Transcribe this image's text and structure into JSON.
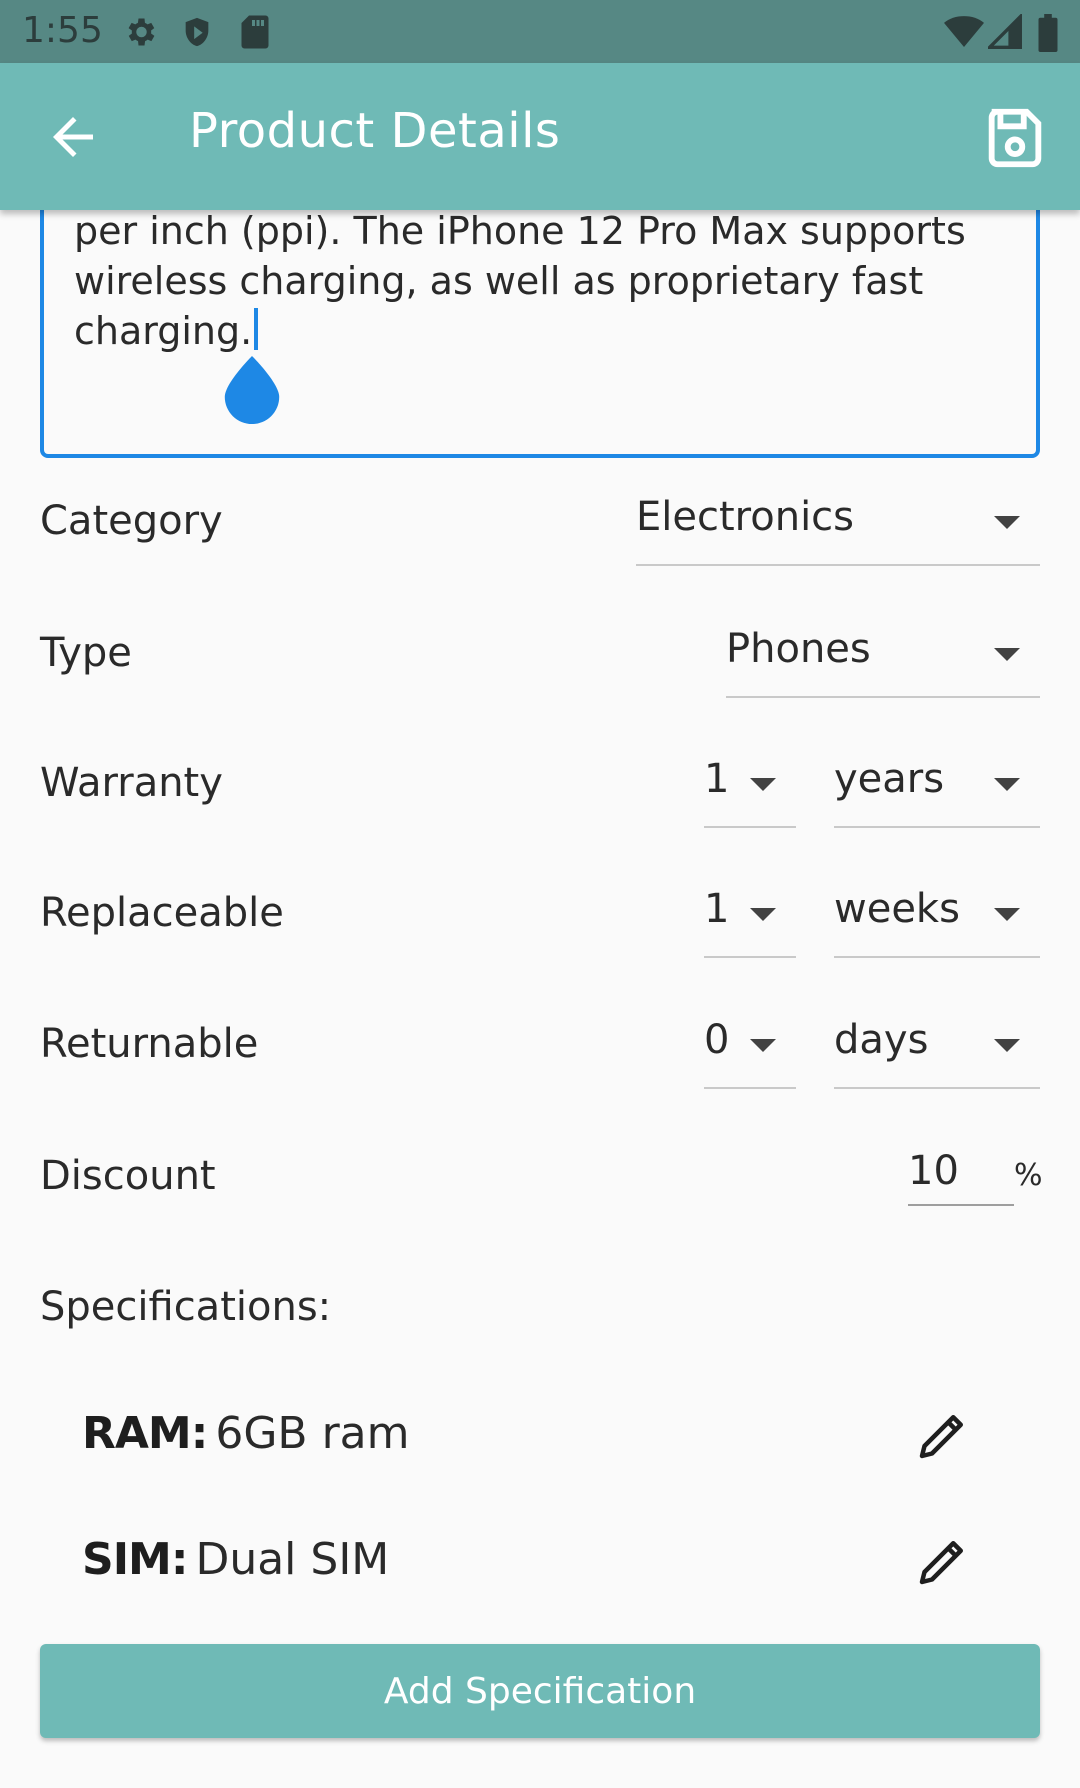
{
  "status_bar": {
    "time": "1:55",
    "icons_left": [
      "gear-icon",
      "shield-play-icon",
      "sd-card-icon"
    ],
    "icons_right": [
      "wifi-icon",
      "cell-signal-icon",
      "battery-icon"
    ]
  },
  "app_bar": {
    "title": "Product Details",
    "back_icon": "arrow-back-icon",
    "save_icon": "save-icon",
    "color": "#6fbab6"
  },
  "description": {
    "line1": "per inch (ppi). The iPhone 12 Pro Max supports",
    "line2": "wireless charging, as well as proprietary fast",
    "line3": "charging.",
    "border_color": "#1e88e5"
  },
  "form": {
    "category": {
      "label": "Category",
      "value": "Electronics"
    },
    "type": {
      "label": "Type",
      "value": "Phones"
    },
    "warranty": {
      "label": "Warranty",
      "amount": "1",
      "unit": "years"
    },
    "replaceable": {
      "label": "Replaceable",
      "amount": "1",
      "unit": "weeks"
    },
    "returnable": {
      "label": "Returnable",
      "amount": "0",
      "unit": "days"
    },
    "discount": {
      "label": "Discount",
      "value": "10",
      "suffix": "%"
    }
  },
  "specifications": {
    "heading": "Specifications:",
    "items": [
      {
        "key": "RAM:",
        "value": "6GB ram"
      },
      {
        "key": "SIM:",
        "value": "Dual SIM"
      }
    ],
    "add_button": "Add Specification"
  }
}
